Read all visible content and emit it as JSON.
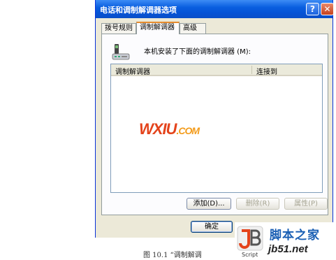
{
  "window": {
    "title": "电话和调制解调器选项"
  },
  "titlebar_buttons": {
    "help": "?",
    "close": "✕"
  },
  "tabs": [
    {
      "label": "拨号规则",
      "active": false
    },
    {
      "label": "调制解调器",
      "active": true
    },
    {
      "label": "高级",
      "active": false
    }
  ],
  "panel": {
    "intro": "本机安装了下面的调制解调器 (M):",
    "columns": [
      "调制解调器",
      "连接到"
    ]
  },
  "buttons": {
    "add": "添加(D)...",
    "remove": "删除(R)",
    "properties": "属性(P)",
    "ok": "确定"
  },
  "watermark": {
    "text": "WXIU",
    "suffix": ".COM"
  },
  "caption": "图 10.1  “调制解调",
  "site_logo": {
    "cn_text": "脚本之家",
    "url": "jb51.net",
    "script_label": "Script"
  },
  "colors": {
    "title_bar": "#0553d6",
    "accent_tab": "#e68b2c",
    "watermark": "#e4431b",
    "logo_blue": "#1a5fb4"
  },
  "icons": [
    "help-icon",
    "close-icon",
    "modem-icon"
  ]
}
